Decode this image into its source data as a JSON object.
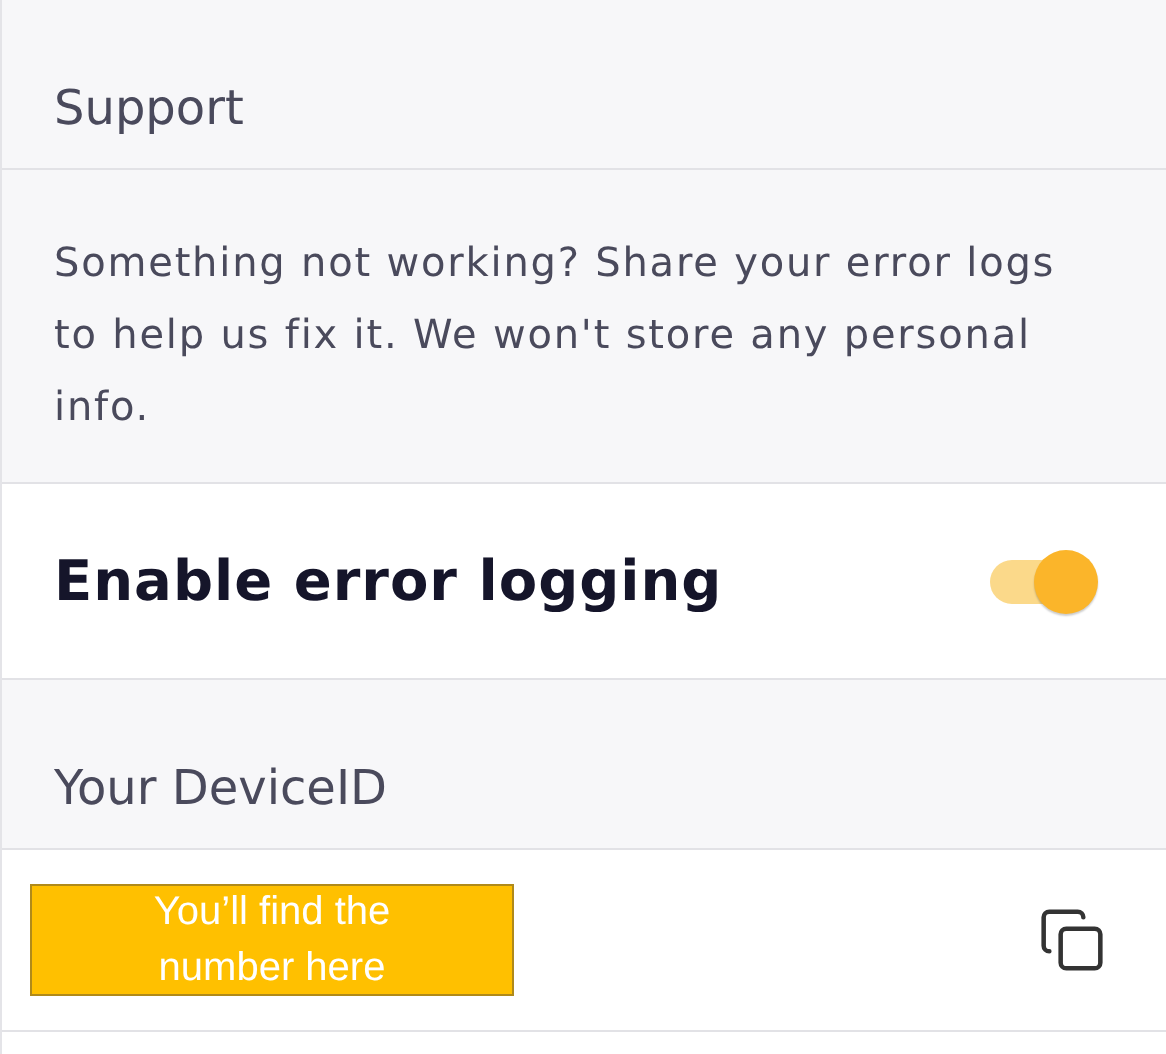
{
  "support_section": {
    "title": "Support",
    "description": "Something not working? Share your error logs to help us fix it. We won't store any personal info."
  },
  "error_logging": {
    "label": "Enable error logging",
    "on": true
  },
  "device_section": {
    "title": "Your DeviceID",
    "annotation": "You’ll find the number here"
  }
}
